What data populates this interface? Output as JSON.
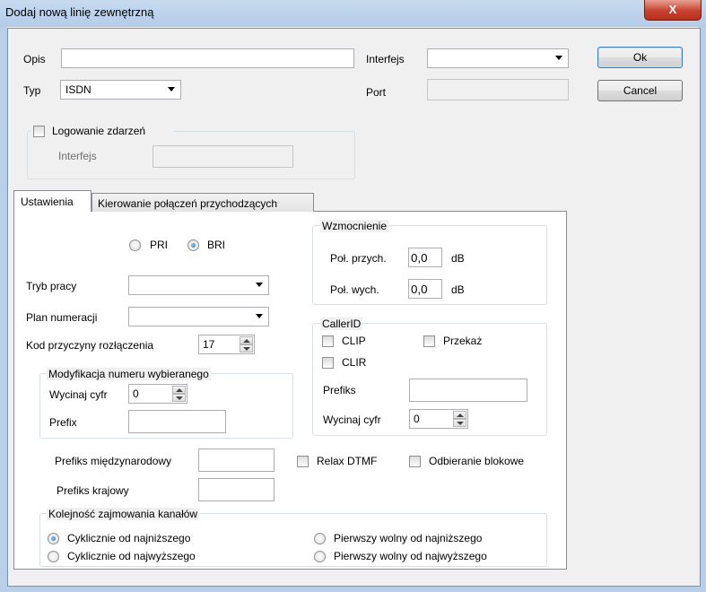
{
  "window": {
    "title": "Dodaj nową linię zewnętrzną",
    "close_glyph": "X"
  },
  "top": {
    "opis_label": "Opis",
    "opis_value": "",
    "typ_label": "Typ",
    "typ_value": "ISDN",
    "interfejs_label": "Interfejs",
    "interfejs_value": "",
    "port_label": "Port",
    "port_value": ""
  },
  "buttons": {
    "ok": "Ok",
    "cancel": "Cancel"
  },
  "logging": {
    "label": "Logowanie zdarzeń",
    "interfejs_label": "Interfejs",
    "interfejs_value": ""
  },
  "tabs": [
    {
      "label": "Ustawienia"
    },
    {
      "label": "Kierowanie połączeń przychodzących"
    }
  ],
  "settings": {
    "pri_label": "PRI",
    "bri_label": "BRI",
    "tryb_label": "Tryb pracy",
    "tryb_value": "",
    "plan_label": "Plan numeracji",
    "plan_value": "",
    "kod_label": "Kod przyczyny rozłączenia",
    "kod_value": "17",
    "mod_group": "Modyfikacja numeru wybieranego",
    "mod_wycinaj_label": "Wycinaj cyfr",
    "mod_wycinaj_value": "0",
    "mod_prefix_label": "Prefix",
    "mod_prefix_value": "",
    "gain_group": "Wzmocnienie",
    "gain_in_label": "Poł. przych.",
    "gain_in_value": "0,0",
    "gain_in_unit": "dB",
    "gain_out_label": "Poł. wych.",
    "gain_out_value": "0,0",
    "gain_out_unit": "dB",
    "callerid_group": "CallerID",
    "clip_label": "CLIP",
    "clir_label": "CLIR",
    "przekaz_label": "Przekaż",
    "cid_prefiks_label": "Prefiks",
    "cid_prefiks_value": "",
    "cid_wycinaj_label": "Wycinaj cyfr",
    "cid_wycinaj_value": "0",
    "intl_label": "Prefiks międzynarodowy",
    "intl_value": "",
    "nat_label": "Prefiks krajowy",
    "nat_value": "",
    "relax_label": "Relax DTMF",
    "block_label": "Odbieranie blokowe",
    "order_group": "Kolejność zajmowania kanałów",
    "order_1": "Cyklicznie od najniższego",
    "order_2": "Cyklicznie od najwyższego",
    "order_3": "Pierwszy wolny od najniższego",
    "order_4": "Pierwszy wolny od najwyższego"
  }
}
